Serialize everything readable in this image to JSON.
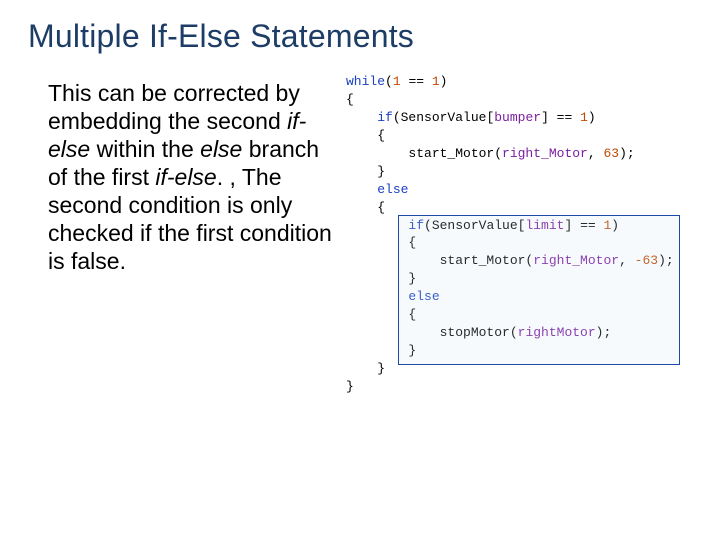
{
  "title": "Multiple If-Else Statements",
  "body": {
    "p1a": "This can be corrected by embedding the second ",
    "p1b": "if-else",
    "p1c": " within the ",
    "p1d": "else",
    "p1e": " branch of the first ",
    "p1f": "if-else",
    "p1g": ".  , The second condition is only checked if the first condition is false."
  },
  "code": {
    "l01a": "while",
    "l01b": "(",
    "l01c": "1",
    "l01d": " == ",
    "l01e": "1",
    "l01f": ")",
    "l02": "{",
    "l03a": "    ",
    "l03b": "if",
    "l03c": "(SensorValue[",
    "l03d": "bumper",
    "l03e": "] == ",
    "l03f": "1",
    "l03g": ")",
    "l04": "    {",
    "l05a": "        start_Motor(",
    "l05b": "right_Motor",
    "l05c": ", ",
    "l05d": "63",
    "l05e": ");",
    "l06": "    }",
    "l07a": "    ",
    "l07b": "else",
    "l08": "    {",
    "l09a": "        ",
    "l09b": "if",
    "l09c": "(SensorValue[",
    "l09d": "limit",
    "l09e": "] == ",
    "l09f": "1",
    "l09g": ")",
    "l10": "        {",
    "l11a": "            start_Motor(",
    "l11b": "right_Motor",
    "l11c": ", ",
    "l11d": "-63",
    "l11e": ");",
    "l12": "        }",
    "l13a": "        ",
    "l13b": "else",
    "l14": "        {",
    "l15a": "            stopMotor(",
    "l15b": "rightMotor",
    "l15c": ");",
    "l16": "        }",
    "l17": "    }",
    "l18": "}"
  }
}
